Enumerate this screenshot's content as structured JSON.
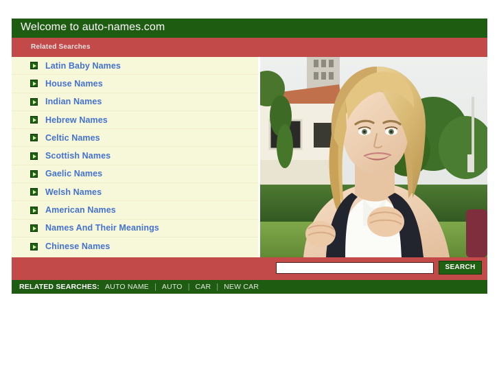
{
  "header": {
    "title": "Welcome to auto-names.com",
    "subtitle": "Related Searches"
  },
  "colors": {
    "green": "#1d5c11",
    "red": "#c24a49",
    "list_background": "#f7f7d9",
    "link_blue": "#4472d0"
  },
  "related_searches_list": [
    {
      "label": "Latin Baby Names",
      "icon": "arrow-right-icon"
    },
    {
      "label": "House Names",
      "icon": "arrow-right-icon"
    },
    {
      "label": "Indian Names",
      "icon": "arrow-right-icon"
    },
    {
      "label": "Hebrew Names",
      "icon": "arrow-right-icon"
    },
    {
      "label": "Celtic Names",
      "icon": "arrow-right-icon"
    },
    {
      "label": "Scottish Names",
      "icon": "arrow-right-icon"
    },
    {
      "label": "Gaelic Names",
      "icon": "arrow-right-icon"
    },
    {
      "label": "Welsh Names",
      "icon": "arrow-right-icon"
    },
    {
      "label": "American Names",
      "icon": "arrow-right-icon"
    },
    {
      "label": "Names And Their Meanings",
      "icon": "arrow-right-icon"
    },
    {
      "label": "Chinese Names",
      "icon": "arrow-right-icon"
    }
  ],
  "photo": {
    "description": "Smiling blonde young woman wearing a backpack outdoors in front of a white building with red tile roof and green hedges"
  },
  "search": {
    "value": "",
    "placeholder": "",
    "button_label": "SEARCH"
  },
  "footer": {
    "label": "RELATED SEARCHES:",
    "separator": "|",
    "links": [
      {
        "label": "AUTO NAME"
      },
      {
        "label": "AUTO"
      },
      {
        "label": "CAR"
      },
      {
        "label": "NEW CAR"
      }
    ]
  }
}
